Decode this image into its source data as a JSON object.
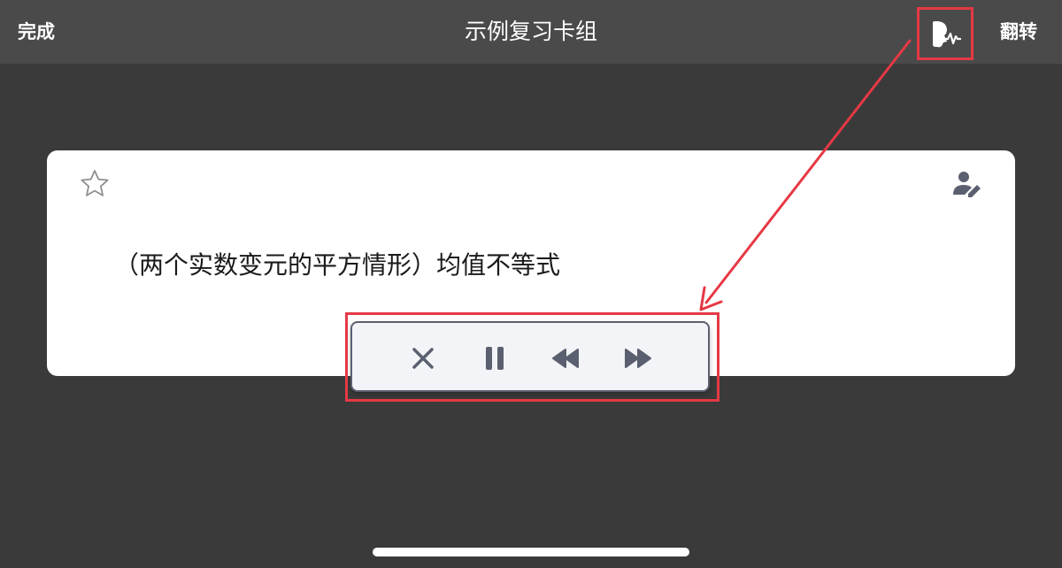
{
  "nav": {
    "done_label": "完成",
    "title": "示例复习卡组",
    "flip_label": "翻转",
    "speak_icon": "speak-audio-icon"
  },
  "card": {
    "text": "（两个实数变元的平方情形）均值不等式",
    "star_icon": "star-outline-icon",
    "edit_icon": "user-edit-icon"
  },
  "player": {
    "buttons": [
      {
        "name": "close",
        "icon": "close-icon"
      },
      {
        "name": "pause",
        "icon": "pause-icon"
      },
      {
        "name": "rewind",
        "icon": "rewind-icon"
      },
      {
        "name": "fast-forward",
        "icon": "fast-forward-icon"
      }
    ]
  },
  "colors": {
    "background": "#3a3a3a",
    "nav_bar": "#4a4a4a",
    "card": "#ffffff",
    "player_icon": "#5b6070",
    "annotation": "#e53945"
  }
}
